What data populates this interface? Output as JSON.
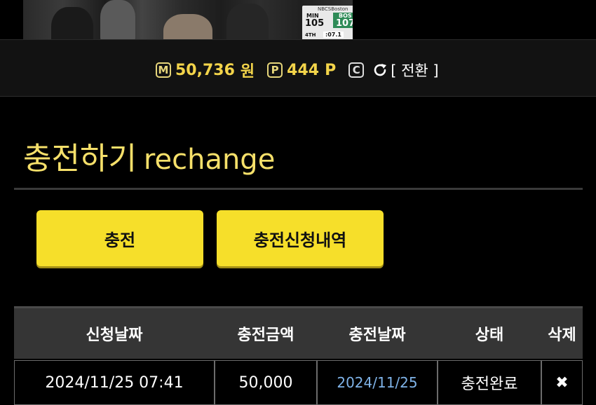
{
  "scorebug": {
    "network": "NBCSBoston",
    "away_team": "MIN",
    "away_score": "105",
    "home_team": "BOS",
    "home_score": "107",
    "period": "4TH",
    "clock": ":07.1"
  },
  "balance": {
    "money_icon": "M",
    "money_value": "50,736",
    "money_unit": "원",
    "point_icon": "P",
    "point_value": "444",
    "point_unit": "P",
    "coin_icon": "C",
    "refresh_icon": "refresh-icon",
    "switch_label": "[ 전환 ]"
  },
  "page": {
    "title_ko": "충전하기",
    "title_en": "rechange"
  },
  "buttons": {
    "charge": "충전",
    "history": "충전신청내역"
  },
  "table": {
    "headers": [
      "신청날짜",
      "충전금액",
      "충전날짜",
      "상태",
      "삭제"
    ],
    "rows": [
      {
        "request_date": "2024/11/25 07:41",
        "amount": "50,000",
        "charge_date": "2024/11/25",
        "status": "충전완료",
        "delete": "✖"
      }
    ]
  },
  "colors": {
    "accent_yellow": "#f6df2a",
    "title_yellow": "#f6e06a",
    "money_yellow": "#f3d44a",
    "date_blue": "#7fb3e8",
    "header_bg": "#353535"
  }
}
